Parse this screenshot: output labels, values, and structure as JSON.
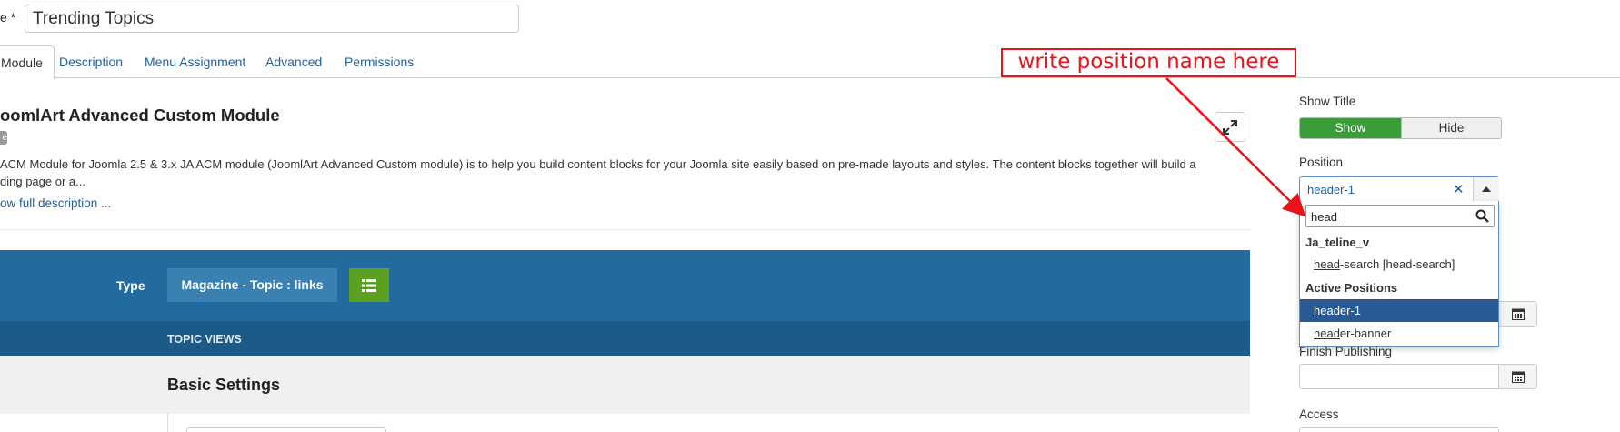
{
  "title_field": {
    "label": "e *",
    "value": "Trending Topics"
  },
  "tabs": [
    {
      "label": "Module"
    },
    {
      "label": "Description"
    },
    {
      "label": "Menu Assignment"
    },
    {
      "label": "Advanced"
    },
    {
      "label": "Permissions"
    }
  ],
  "module": {
    "title": "oomlArt Advanced Custom Module",
    "badge": "e",
    "description_line1": "ACM Module for Joomla 2.5 & 3.x JA ACM module (JoomlArt Advanced Custom module) is to help you build content blocks for your Joomla site easily based on pre-made layouts and styles. The content blocks together will build a",
    "description_line2": "ding page or a...",
    "show_full_link": "ow full description ..."
  },
  "acm": {
    "type_label": "Type",
    "type_value": "Magazine - Topic : links",
    "section_label": "TOPIC VIEWS",
    "basic_settings": "Basic Settings"
  },
  "sidebar": {
    "show_title_label": "Show Title",
    "show_label": "Show",
    "hide_label": "Hide",
    "position_label": "Position",
    "position_value": "header-1",
    "search_value": "head",
    "groups": [
      {
        "label": "Ja_teline_v",
        "options": [
          {
            "match": "head",
            "rest": "-search [head-search]"
          }
        ]
      },
      {
        "label": "Active Positions",
        "options": [
          {
            "match": "head",
            "rest": "er-1"
          },
          {
            "match": "head",
            "rest": "er-banner"
          }
        ]
      }
    ],
    "finish_publishing_label": "Finish Publishing",
    "access_label": "Access"
  },
  "annotation": {
    "text": "write position name here",
    "color": "#e8131b"
  },
  "colors": {
    "accent_blue": "#216b9e",
    "dark_blue": "#1c5a88",
    "green": "#3a9d3a",
    "link": "#225f9c",
    "highlight": "#2a5a95"
  }
}
